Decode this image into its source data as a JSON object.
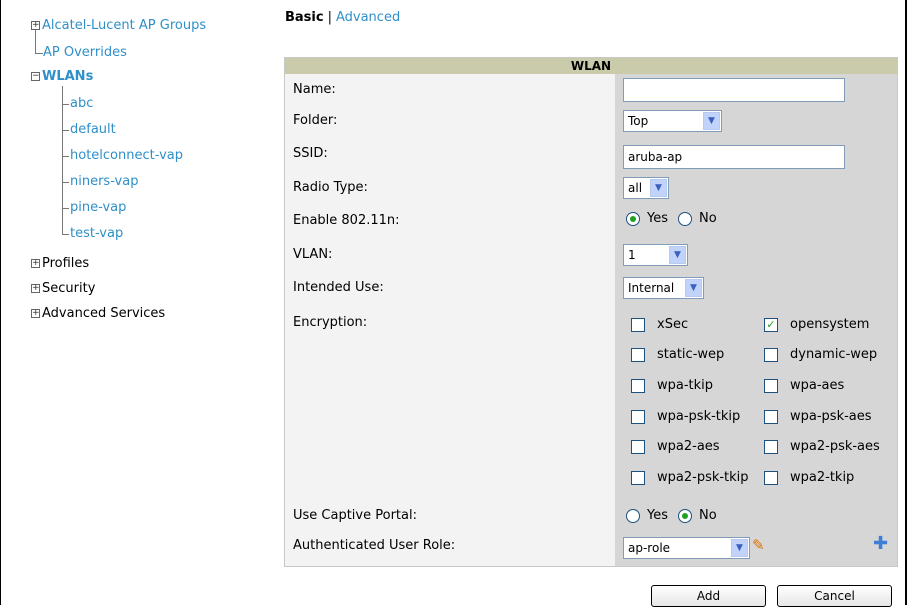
{
  "tree": {
    "items": [
      {
        "label": "Alcatel-Lucent AP Groups"
      },
      {
        "label": "AP Overrides"
      },
      {
        "label": "WLANs"
      },
      {
        "label": "abc"
      },
      {
        "label": "default"
      },
      {
        "label": "hotelconnect-vap"
      },
      {
        "label": "niners-vap"
      },
      {
        "label": "pine-vap"
      },
      {
        "label": "test-vap"
      },
      {
        "label": "Profiles"
      },
      {
        "label": "Security"
      },
      {
        "label": "Advanced Services"
      }
    ]
  },
  "tabs": {
    "basic": "Basic",
    "separator": "|",
    "advanced": "Advanced"
  },
  "panel": {
    "title": "WLAN",
    "fields": {
      "name": {
        "label": "Name:",
        "value": ""
      },
      "folder": {
        "label": "Folder:",
        "value": "Top"
      },
      "ssid": {
        "label": "SSID:",
        "value": "aruba-ap"
      },
      "radio_type": {
        "label": "Radio Type:",
        "value": "all"
      },
      "enable_80211n": {
        "label": "Enable 802.11n:",
        "yes": "Yes",
        "no": "No",
        "selected": "Yes"
      },
      "vlan": {
        "label": "VLAN:",
        "value": "1"
      },
      "intended_use": {
        "label": "Intended Use:",
        "value": "Internal"
      },
      "encryption": {
        "label": "Encryption:",
        "options": [
          {
            "label": "xSec",
            "checked": false
          },
          {
            "label": "opensystem",
            "checked": true
          },
          {
            "label": "static-wep",
            "checked": false
          },
          {
            "label": "dynamic-wep",
            "checked": false
          },
          {
            "label": "wpa-tkip",
            "checked": false
          },
          {
            "label": "wpa-aes",
            "checked": false
          },
          {
            "label": "wpa-psk-tkip",
            "checked": false
          },
          {
            "label": "wpa-psk-aes",
            "checked": false
          },
          {
            "label": "wpa2-aes",
            "checked": false
          },
          {
            "label": "wpa2-psk-aes",
            "checked": false
          },
          {
            "label": "wpa2-psk-tkip",
            "checked": false
          },
          {
            "label": "wpa2-tkip",
            "checked": false
          }
        ]
      },
      "captive_portal": {
        "label": "Use Captive Portal:",
        "yes": "Yes",
        "no": "No",
        "selected": "No"
      },
      "auth_role": {
        "label": "Authenticated User Role:",
        "value": "ap-role"
      }
    }
  },
  "buttons": {
    "add": "Add",
    "cancel": "Cancel"
  },
  "icons": {
    "edit": "pencil-icon",
    "add": "plus-icon",
    "check": "✓"
  },
  "colors": {
    "link": "#2f8fc8",
    "header": "#c9cbaa",
    "radio_dot": "#21a121"
  }
}
